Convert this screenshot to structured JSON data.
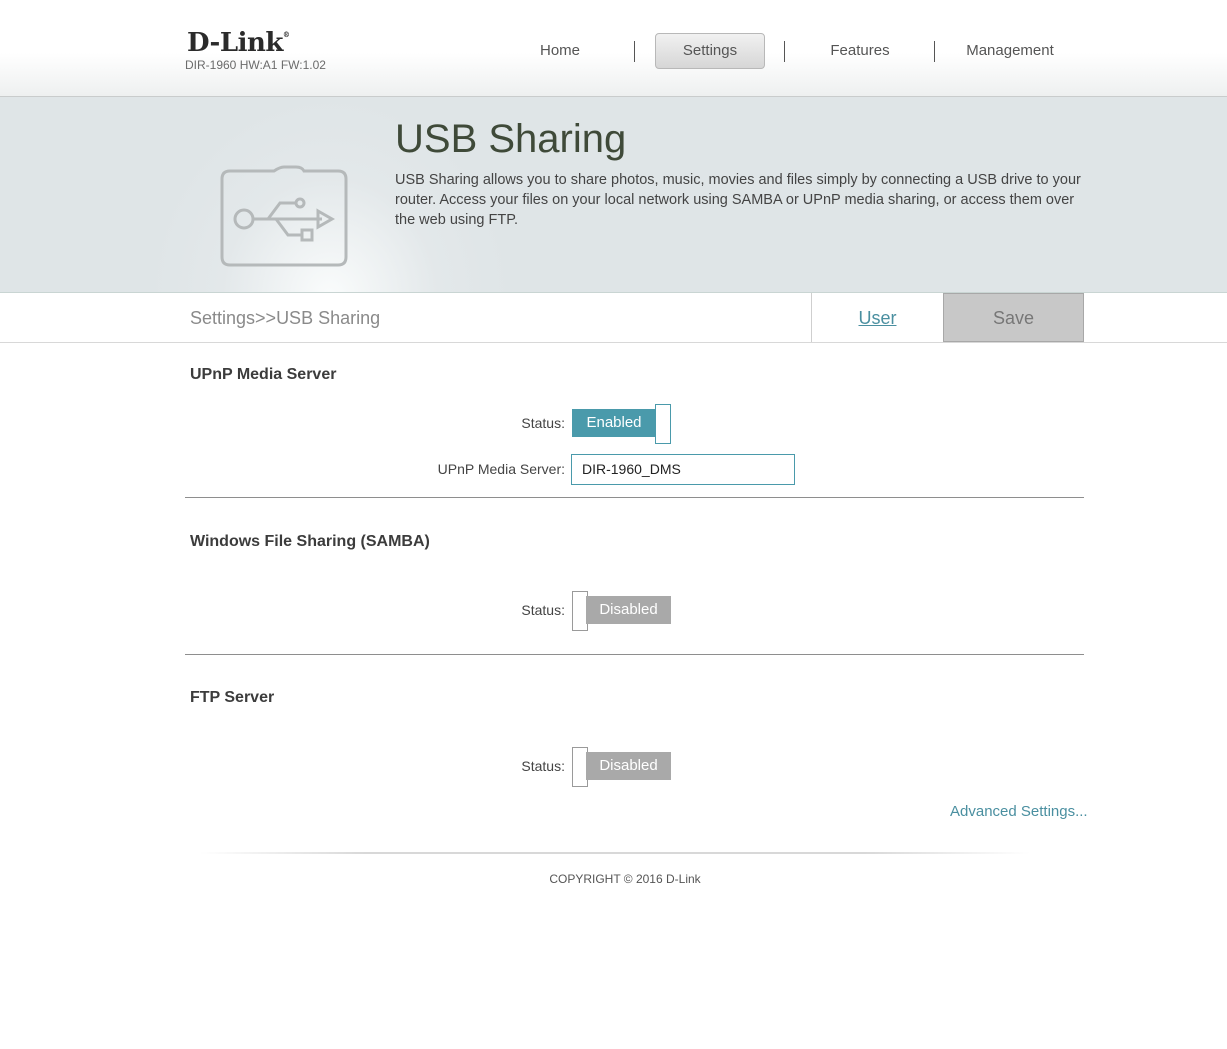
{
  "header": {
    "logo": "D-Link",
    "model": "DIR-1960 HW:A1 FW:1.02",
    "nav": [
      {
        "label": "Home"
      },
      {
        "label": "Settings",
        "active": true
      },
      {
        "label": "Features"
      },
      {
        "label": "Management"
      }
    ]
  },
  "banner": {
    "icon": "usb-drive-icon",
    "title": "USB Sharing",
    "description": "USB Sharing allows you to share photos, music, movies and files simply by connecting a USB drive to your router. Access your files on your local network using SAMBA or UPnP media sharing, or access them over the web using FTP."
  },
  "toolbar": {
    "breadcrumb": "Settings>>USB Sharing",
    "user_label": "User",
    "save_label": "Save"
  },
  "upnp": {
    "title": "UPnP Media Server",
    "status_label": "Status:",
    "status_value": "Enabled",
    "server_label": "UPnP Media Server:",
    "server_value": "DIR-1960_DMS"
  },
  "samba": {
    "title": "Windows File Sharing (SAMBA)",
    "status_label": "Status:",
    "status_value": "Disabled"
  },
  "ftp": {
    "title": "FTP Server",
    "status_label": "Status:",
    "status_value": "Disabled",
    "advanced_link": "Advanced Settings..."
  },
  "footer": {
    "copyright": "COPYRIGHT © 2016 D-Link"
  },
  "colors": {
    "accent": "#4a9aab",
    "disabled": "#a9a9a9",
    "title": "#3f4a39"
  }
}
